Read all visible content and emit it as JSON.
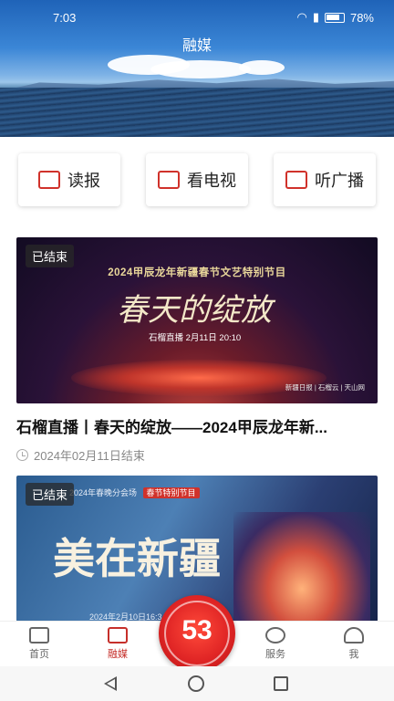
{
  "status_bar": {
    "time": "7:03",
    "battery": "78%"
  },
  "header": {
    "title": "融媒"
  },
  "quick_actions": [
    {
      "label": "读报",
      "icon": "newspaper-icon"
    },
    {
      "label": "看电视",
      "icon": "tv-icon"
    },
    {
      "label": "听广播",
      "icon": "radio-icon"
    }
  ],
  "cards": [
    {
      "badge": "已结束",
      "poster_heading": "2024甲辰龙年新疆春节文艺特别节目",
      "poster_title": "春天的绽放",
      "poster_sub": "石榴直播  2月11日 20:10",
      "poster_logos": "新疆日报 | 石榴云 | 天山网",
      "title": "石榴直播丨春天的绽放——2024甲辰龙年新...",
      "meta": "2024年02月11日结束"
    },
    {
      "badge": "已结束",
      "poster_heading": "2024年春晚分会场",
      "poster_tag": "春节特别节目",
      "poster_title": "美在新疆",
      "poster_date": "2024年2月10日16:3"
    }
  ],
  "tabbar": {
    "items": [
      {
        "label": "首页",
        "icon": "home-news-icon",
        "active": false
      },
      {
        "label": "融媒",
        "icon": "media-icon",
        "active": true
      },
      {
        "label": "服务",
        "icon": "heart-hands-icon",
        "active": false
      },
      {
        "label": "我",
        "icon": "user-icon",
        "active": false
      }
    ],
    "center_logo": "53"
  },
  "colors": {
    "accent": "#c62f2a",
    "badge_bg": "#333333"
  }
}
